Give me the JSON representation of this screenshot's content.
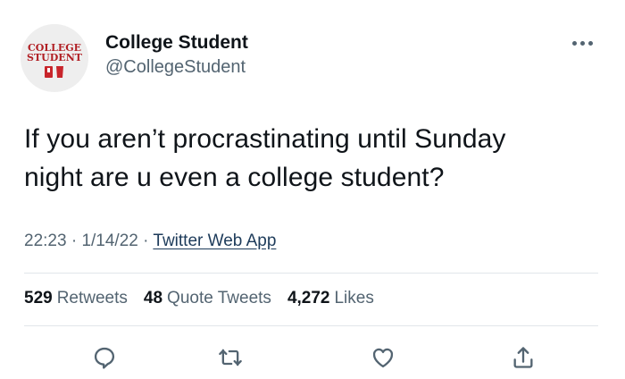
{
  "author": {
    "name": "College Student",
    "handle": "@CollegeStudent",
    "avatar_logo_text": [
      "COLLEGE",
      "STUDENT"
    ],
    "avatar_colors": {
      "text": "#b11f24",
      "bg": "#eeeeee"
    }
  },
  "tweet": {
    "text_line1": "If you aren’t procrastinating until Sunday",
    "text_line2": "night are u even a college student?",
    "time": "22:23",
    "separator": " · ",
    "date": "1/14/22",
    "source": "Twitter Web App"
  },
  "stats": {
    "retweets_count": "529",
    "retweets_label": "Retweets",
    "quotes_count": "48",
    "quotes_label": "Quote Tweets",
    "likes_count": "4,272",
    "likes_label": "Likes"
  },
  "actions": {
    "reply_icon": "reply-icon",
    "retweet_icon": "retweet-icon",
    "like_icon": "heart-icon",
    "share_icon": "share-icon"
  },
  "colors": {
    "text_primary": "#0f1419",
    "text_secondary": "#536471",
    "divider": "#e1e6ea"
  }
}
